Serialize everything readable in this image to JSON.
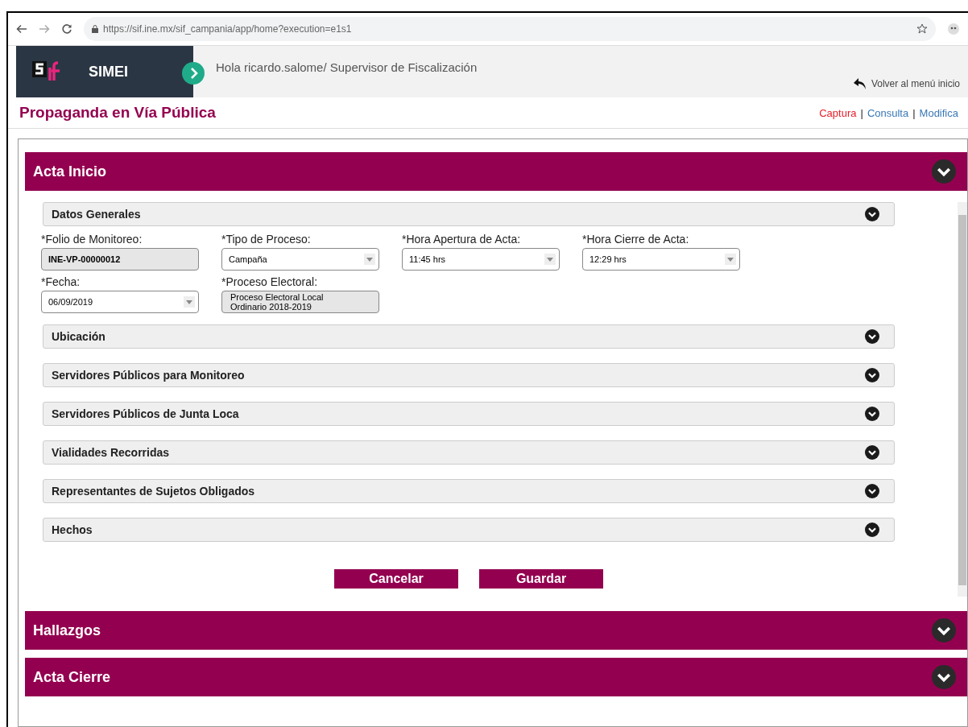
{
  "browser": {
    "url": "https://sif.ine.mx/sif_campania/app/home?execution=e1s1"
  },
  "header": {
    "app_name": "SIMEI",
    "greeting": "Hola ricardo.salome/ Supervisor de Fiscalización",
    "back_link": "Volver al menú inicio"
  },
  "page": {
    "title": "Propaganda en Vía Pública",
    "separator": "|",
    "modes": [
      {
        "label": "Captura",
        "selected": true
      },
      {
        "label": "Consulta",
        "selected": false
      },
      {
        "label": "Modifica",
        "selected": false
      }
    ]
  },
  "sections": [
    {
      "title": "Acta Inicio",
      "subsections": [
        {
          "title": "Datos Generales",
          "fields": [
            {
              "label": "*Folio de Monitoreo:",
              "kind": "readonly",
              "value": "INE-VP-00000012",
              "bold": true
            },
            {
              "label": "*Tipo de Proceso:",
              "kind": "select",
              "value": "Campaña"
            },
            {
              "label": "*Hora Apertura de Acta:",
              "kind": "select",
              "value": "11:45 hrs"
            },
            {
              "label": "*Hora Cierre de Acta:",
              "kind": "select",
              "value": "12:29 hrs"
            },
            {
              "label": "*Fecha:",
              "kind": "select",
              "value": "06/09/2019"
            },
            {
              "label": "*Proceso Electoral:",
              "kind": "readonly",
              "value": "Proceso Electoral Local Ordinario 2018-2019",
              "bold": false
            }
          ]
        },
        {
          "title": "Ubicación"
        },
        {
          "title": "Servidores Públicos para Monitoreo"
        },
        {
          "title": "Servidores Públicos de Junta Loca"
        },
        {
          "title": "Vialidades Recorridas"
        },
        {
          "title": "Representantes de Sujetos Obligados"
        },
        {
          "title": "Hechos"
        }
      ],
      "buttons": [
        "Cancelar",
        "Guardar"
      ]
    },
    {
      "title": "Hallazgos"
    },
    {
      "title": "Acta Cierre"
    }
  ]
}
